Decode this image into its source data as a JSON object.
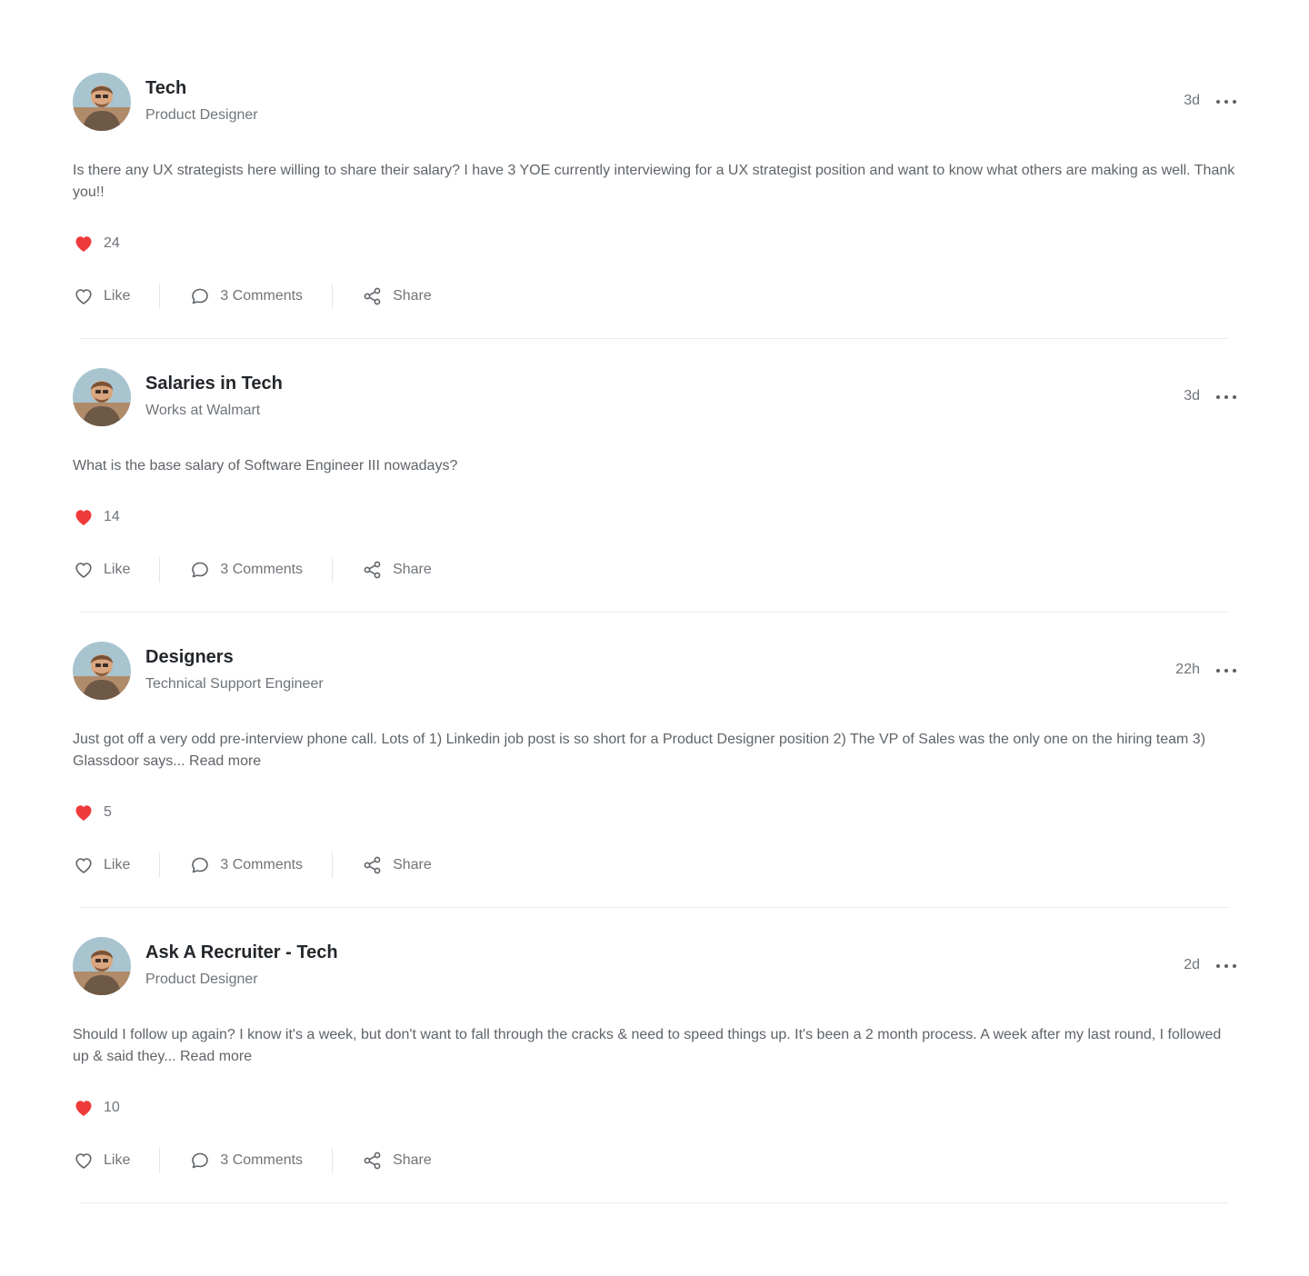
{
  "colors": {
    "heart": "#ef3b3b",
    "text_primary": "#23272b",
    "text_secondary": "#6f7479",
    "divider": "#ececec"
  },
  "icons": {
    "avatar": "user-avatar-photo",
    "reaction": "heart-filled-icon",
    "like": "heart-outline-icon",
    "comments": "chat-bubble-icon",
    "share": "share-nodes-icon",
    "more": "ellipsis-horizontal-icon"
  },
  "posts": [
    {
      "group": "Tech",
      "subtitle": "Product Designer",
      "time": "3d",
      "body": "Is there any UX strategists here willing to share their salary? I have 3 YOE currently interviewing for a UX strategist position and want to know what others are making as well. Thank you!!",
      "likes": "24",
      "like_label": "Like",
      "comments_label": "3 Comments",
      "share_label": "Share"
    },
    {
      "group": "Salaries in Tech",
      "subtitle": "Works at Walmart",
      "time": "3d",
      "body": "What is the base salary of Software Engineer III nowadays?",
      "likes": "14",
      "like_label": "Like",
      "comments_label": "3 Comments",
      "share_label": "Share"
    },
    {
      "group": "Designers",
      "subtitle": "Technical Support Engineer",
      "time": "22h",
      "body": "Just got off a very odd pre-interview phone call. Lots of 1) Linkedin job post is so short for a Product Designer position 2) The VP of Sales was the only one on the hiring team 3) Glassdoor says... Read more",
      "likes": "5",
      "like_label": "Like",
      "comments_label": "3 Comments",
      "share_label": "Share"
    },
    {
      "group": "Ask A Recruiter - Tech",
      "subtitle": "Product Designer",
      "time": "2d",
      "body": "Should I follow up again? I know it's a week, but don't want to fall through the cracks & need to speed things up. It's been a 2 month process. A week after my last round, I followed up & said they... Read more",
      "likes": "10",
      "like_label": "Like",
      "comments_label": "3 Comments",
      "share_label": "Share"
    }
  ]
}
